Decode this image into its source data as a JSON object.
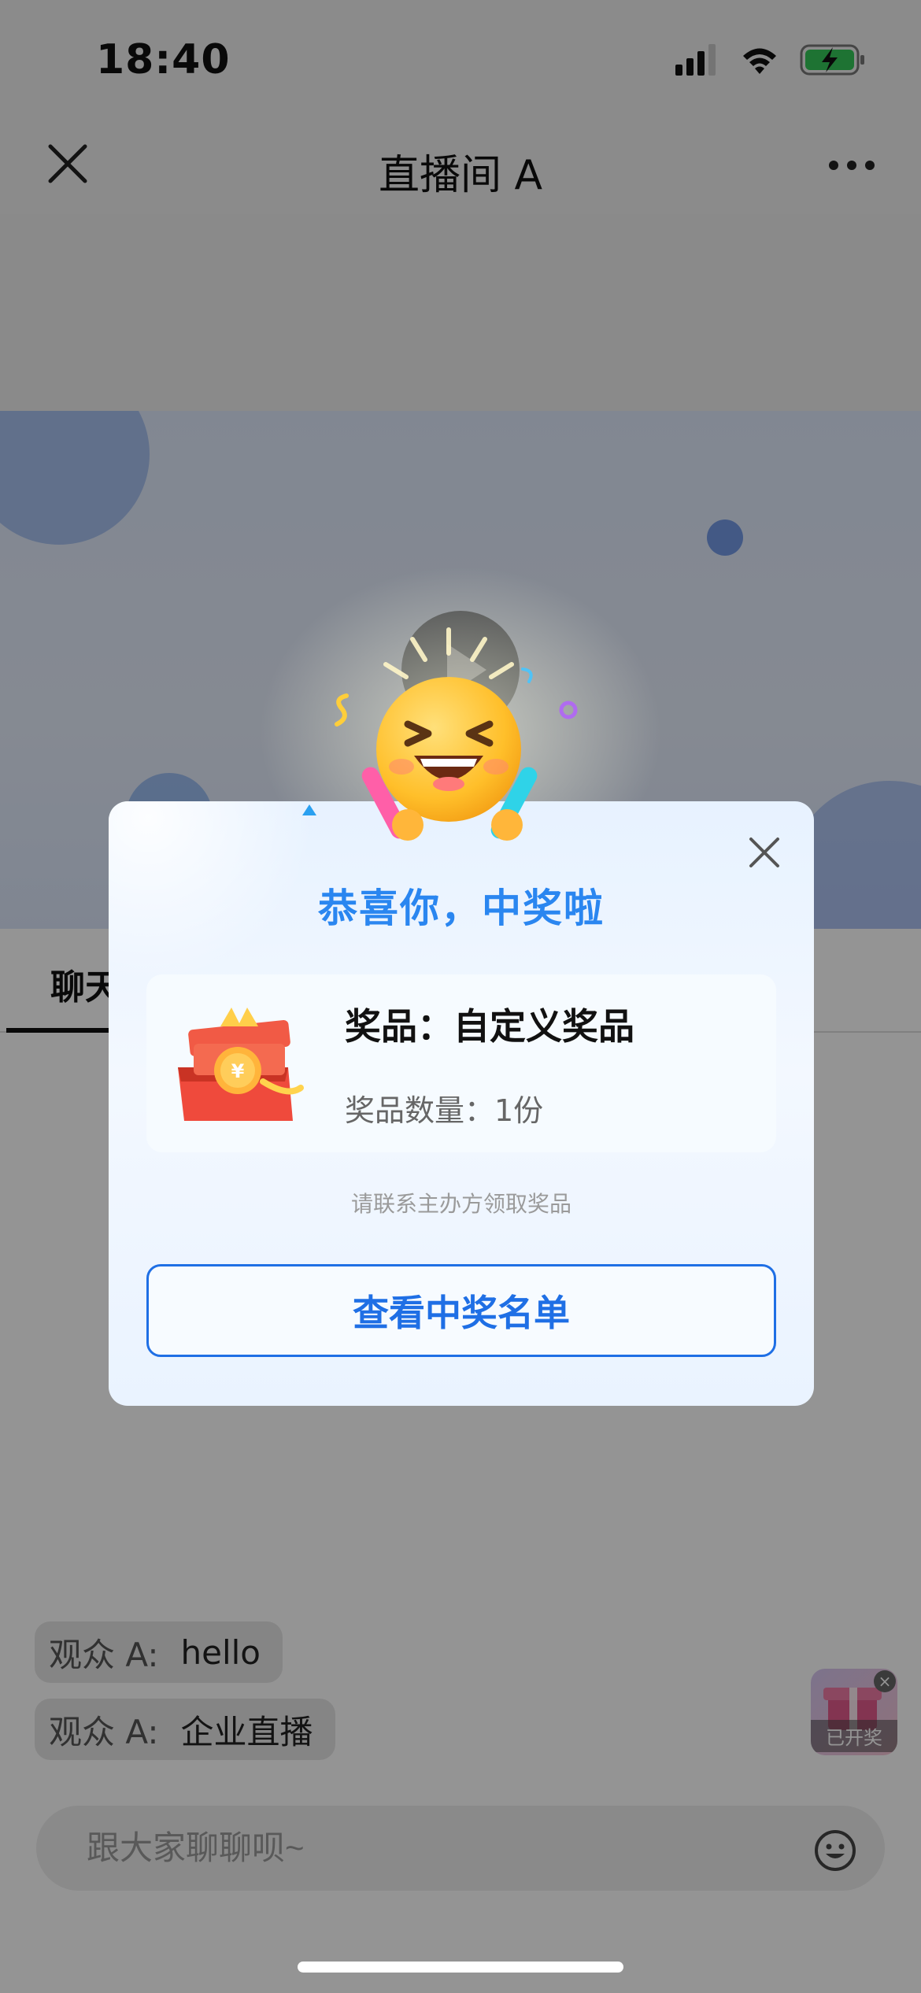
{
  "status_bar": {
    "time": "18:40"
  },
  "nav": {
    "title": "直播间 A"
  },
  "tabs": {
    "chat_label": "聊天"
  },
  "chat": {
    "messages": [
      {
        "user": "观众 A:",
        "text": "hello"
      },
      {
        "user": "观众 A:",
        "text": "企业直播"
      }
    ],
    "input_placeholder": "跟大家聊聊呗~"
  },
  "lottery_badge": {
    "label": "已开奖"
  },
  "modal": {
    "title": "恭喜你，中奖啦",
    "prize_name": "奖品：自定义奖品",
    "prize_quantity": "奖品数量：1份",
    "hint": "请联系主办方领取奖品",
    "button_label": "查看中奖名单"
  },
  "colors": {
    "accent": "#1f6fe5",
    "title_blue": "#2a86f0",
    "battery_green": "#34c759"
  },
  "icons": [
    "signal-icon",
    "wifi-icon",
    "battery-charging-icon",
    "close-icon",
    "more-icon",
    "play-icon",
    "emoji-icon",
    "gift-icon",
    "celebrate-emoji-icon"
  ]
}
